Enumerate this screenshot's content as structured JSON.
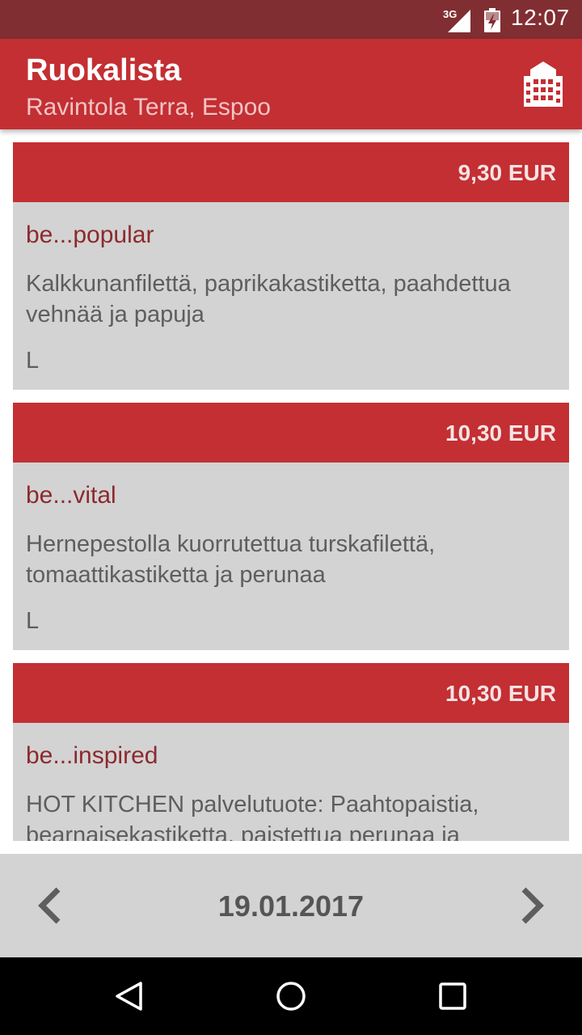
{
  "status_bar": {
    "network": "3G",
    "time": "12:07",
    "icons": [
      "signal-icon",
      "battery-charging-icon"
    ]
  },
  "app_bar": {
    "title": "Ruokalista",
    "subtitle": "Ravintola Terra, Espoo",
    "action_icon": "building-icon"
  },
  "menu": {
    "items": [
      {
        "price": "9,30 EUR",
        "category": "be...popular",
        "description": "Kalkkunanfilettä, paprikakastiketta, paahdettua vehnää ja papuja",
        "diet": "L"
      },
      {
        "price": "10,30 EUR",
        "category": "be...vital",
        "description": "Hernepestolla kuorrutettua turskafilettä, tomaattikastiketta ja perunaa",
        "diet": "L"
      },
      {
        "price": "10,30 EUR",
        "category": "be...inspired",
        "description": "HOT KITCHEN palvelutuote: Paahtopaistia, bearnaisekastiketta, paistettua perunaa ja",
        "diet": ""
      }
    ]
  },
  "date_nav": {
    "date": "19.01.2017",
    "prev_icon": "chevron-left-icon",
    "next_icon": "chevron-right-icon"
  },
  "system_nav": {
    "icons": [
      "back-icon",
      "home-icon",
      "recents-icon"
    ]
  },
  "colors": {
    "status_bar": "#812e32",
    "primary": "#c32f33",
    "card_background": "#d3d3d3",
    "category_text": "#8c2a2e",
    "body_text": "#5e5e5e"
  }
}
